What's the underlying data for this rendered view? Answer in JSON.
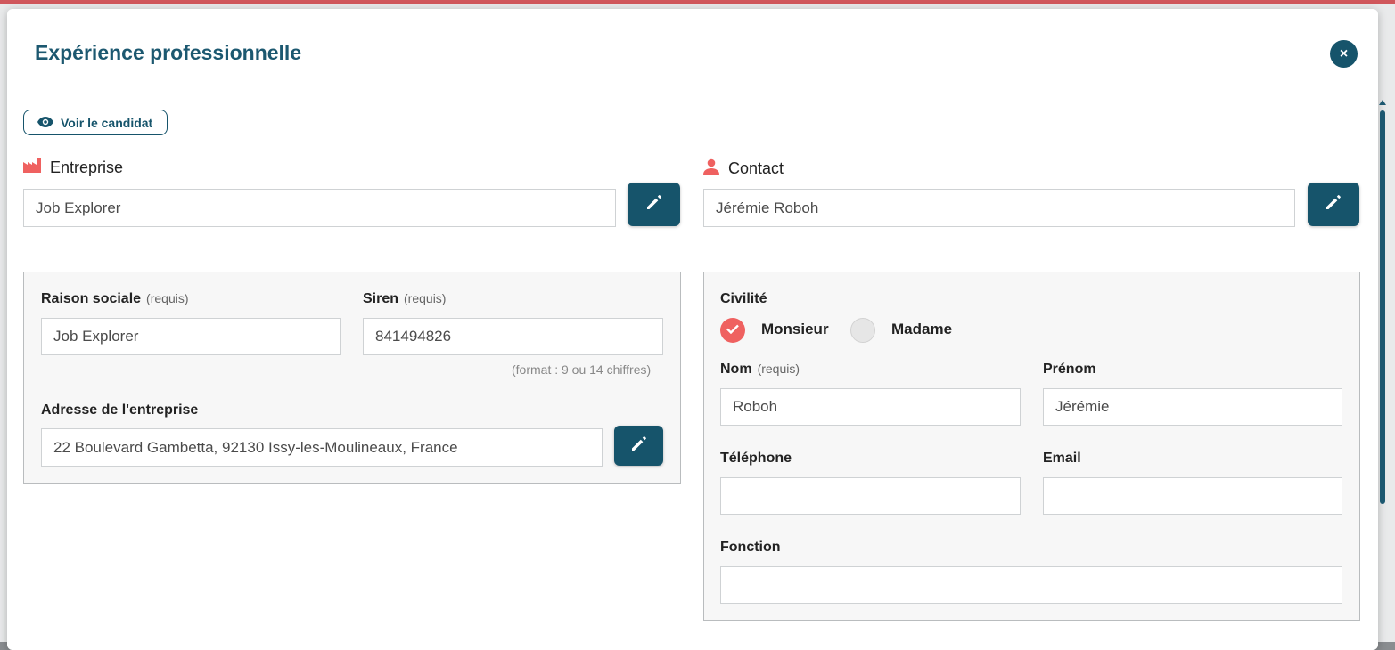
{
  "modal": {
    "title": "Expérience professionnelle",
    "close_icon": "×",
    "view_candidate_label": "Voir le candidat"
  },
  "company": {
    "heading": "Entreprise",
    "value": "Job Explorer",
    "raison_sociale_label": "Raison sociale",
    "raison_sociale_req": "(requis)",
    "raison_sociale_value": "Job Explorer",
    "siren_label": "Siren",
    "siren_req": "(requis)",
    "siren_value": "841494826",
    "siren_hint": "(format : 9 ou 14 chiffres)",
    "address_label": "Adresse de l'entreprise",
    "address_value": "22 Boulevard Gambetta, 92130 Issy-les-Moulineaux, France"
  },
  "contact": {
    "heading": "Contact",
    "value": "Jérémie Roboh",
    "civility_label": "Civilité",
    "option_monsieur": "Monsieur",
    "option_madame": "Madame",
    "selected": "Monsieur",
    "nom_label": "Nom",
    "nom_req": "(requis)",
    "nom_value": "Roboh",
    "prenom_label": "Prénom",
    "prenom_value": "Jérémie",
    "telephone_label": "Téléphone",
    "telephone_value": "",
    "email_label": "Email",
    "email_value": "",
    "fonction_label": "Fonction",
    "fonction_value": ""
  },
  "colors": {
    "primary": "#16546b",
    "accent": "#ef6160",
    "panel_bg": "#f7f7f7"
  }
}
